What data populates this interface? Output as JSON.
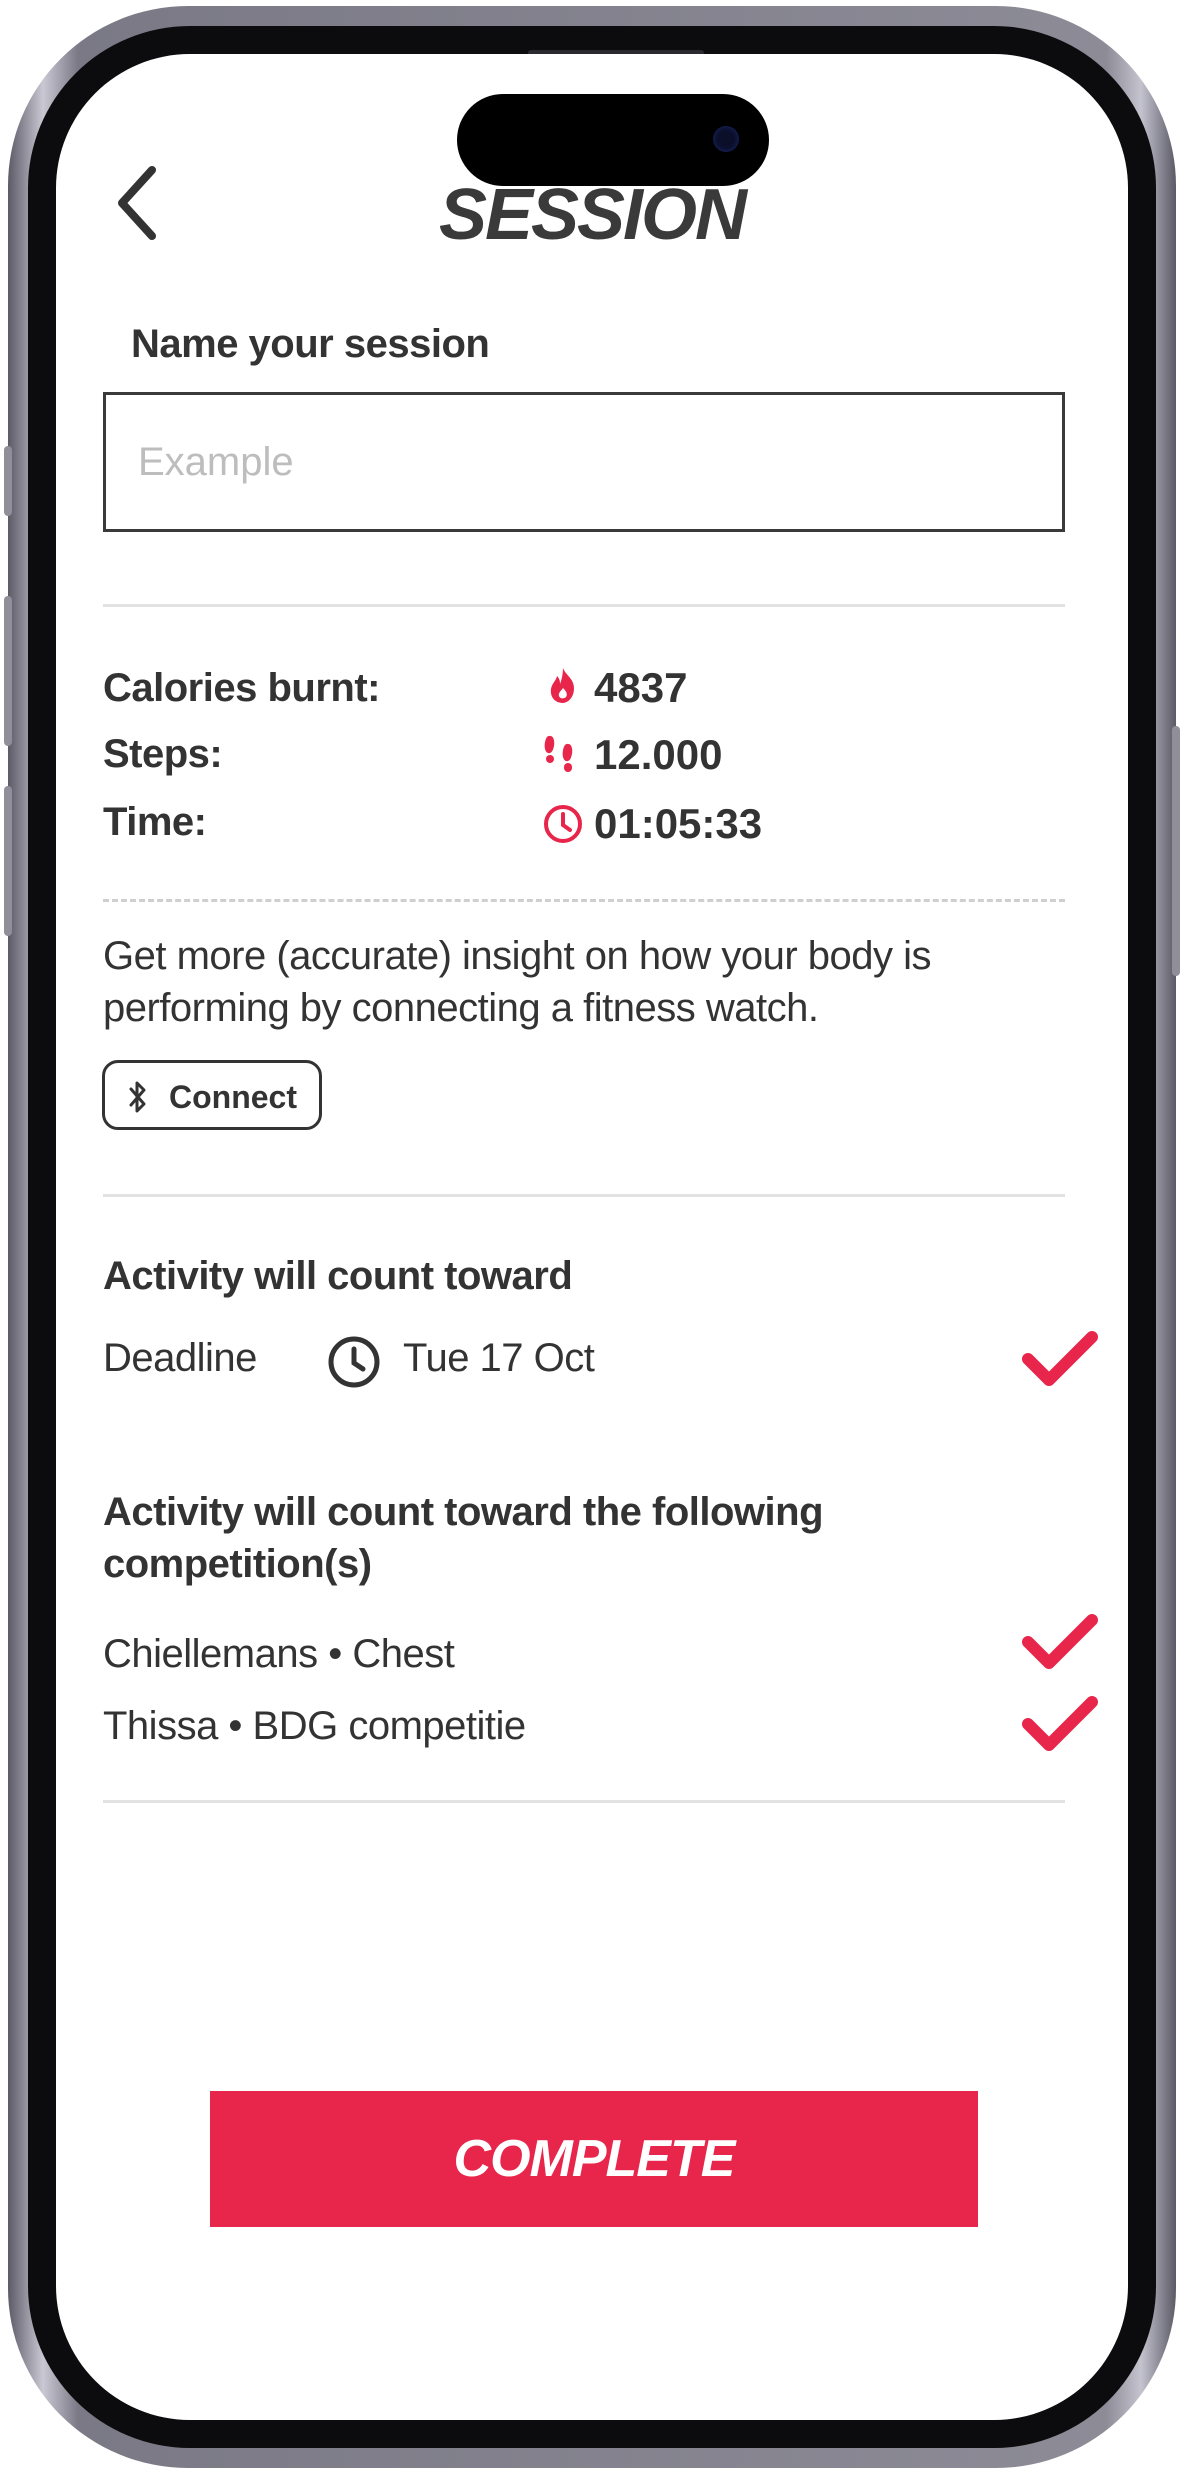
{
  "header": {
    "title": "SESSION"
  },
  "form": {
    "name_label": "Name your session",
    "name_placeholder": "Example",
    "name_value": ""
  },
  "stats": [
    {
      "label": "Calories burnt:",
      "icon": "flame-icon",
      "value": "4837"
    },
    {
      "label": "Steps:",
      "icon": "footsteps-icon",
      "value": "12.000"
    },
    {
      "label": "Time:",
      "icon": "clock-icon",
      "value": "01:05:33"
    }
  ],
  "watch": {
    "info_text": "Get more (accurate) insight on how your body is performing by connecting a fitness watch.",
    "connect_label": "Connect",
    "connect_icon": "bluetooth-icon"
  },
  "deadline_section": {
    "title": "Activity will count toward",
    "label": "Deadline",
    "icon": "clock-icon",
    "date": "Tue 17 Oct",
    "checked": true
  },
  "competitions_section": {
    "title": "Activity will count toward the following competition(s)",
    "items": [
      {
        "text": "Chiellemans • Chest",
        "checked": true
      },
      {
        "text": "Thissa • BDG competitie",
        "checked": true
      }
    ]
  },
  "actions": {
    "complete_label": "COMPLETE"
  },
  "colors": {
    "accent": "#e8254a",
    "text": "#333333",
    "divider": "#e2e2e2",
    "placeholder": "#bdbdbd"
  }
}
